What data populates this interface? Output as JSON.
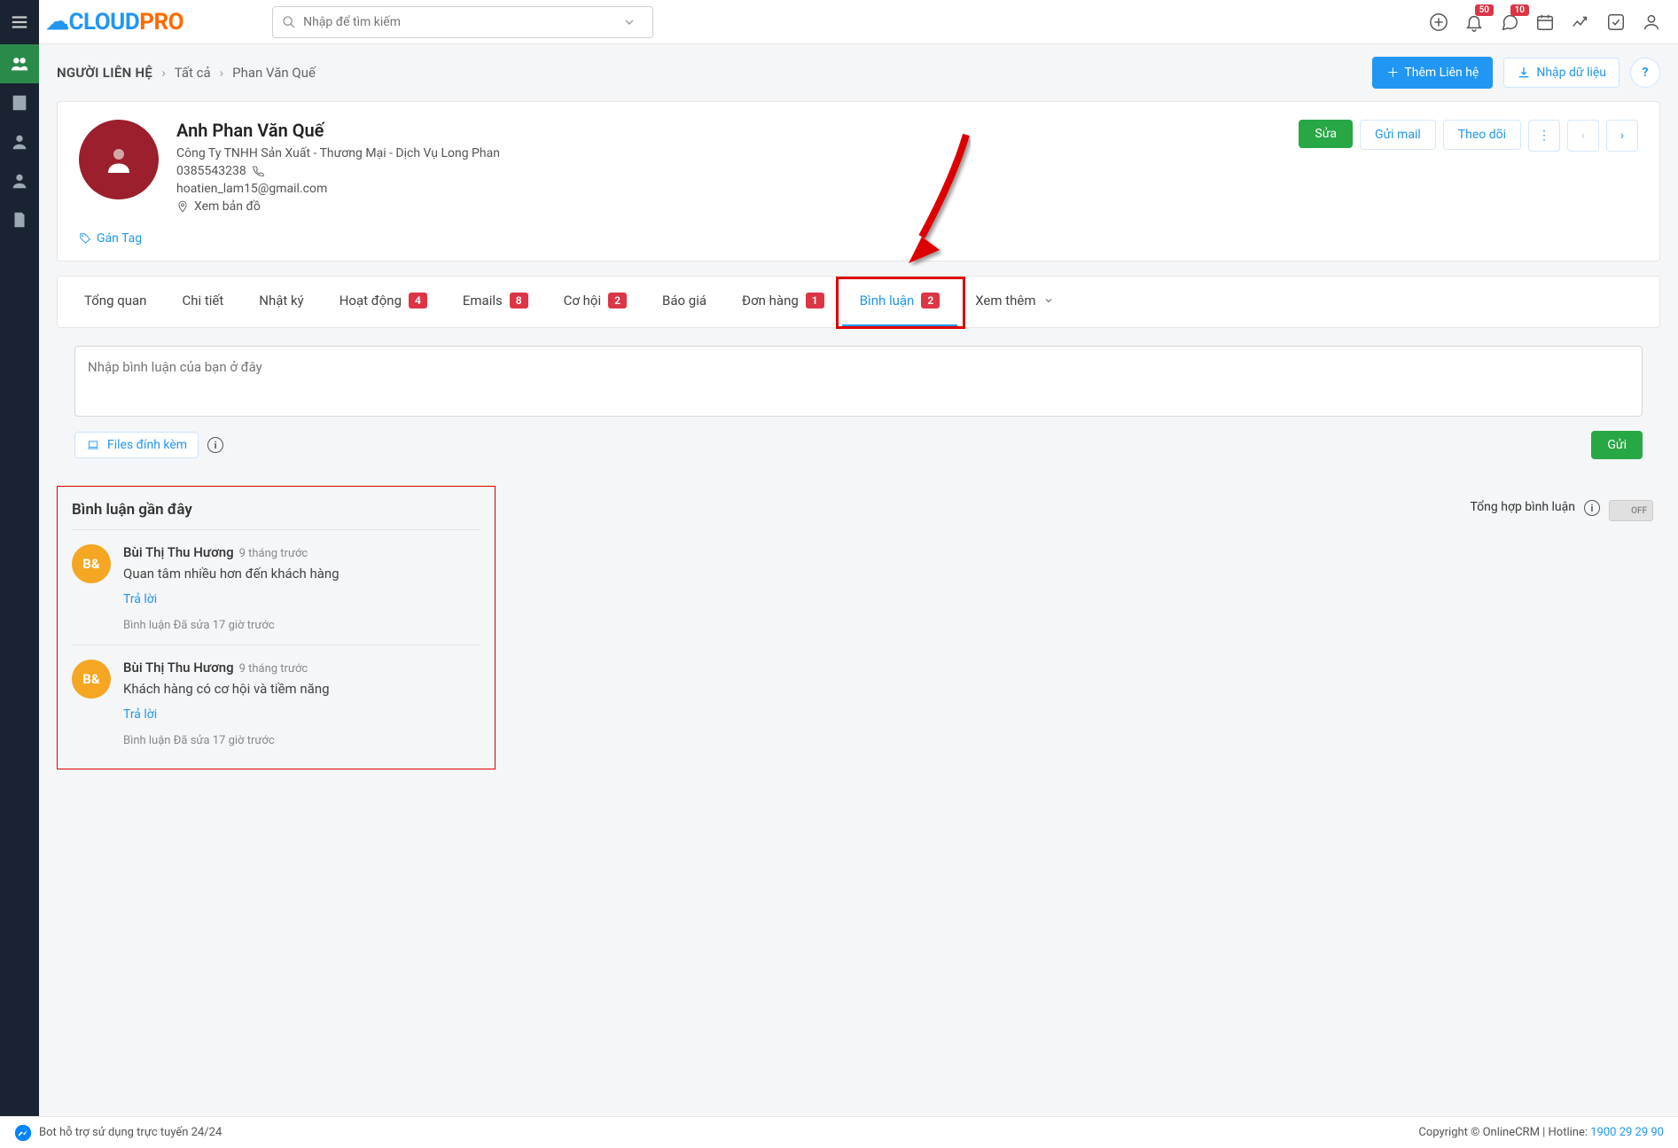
{
  "header": {
    "search_placeholder": "Nhập để tìm kiếm",
    "notif_count": "50",
    "chat_count": "10"
  },
  "breadcrumb": {
    "module": "NGƯỜI LIÊN HỆ",
    "filter": "Tất cả",
    "record": "Phan Văn Quế"
  },
  "page_actions": {
    "add_contact": "Thêm Liên hệ",
    "import": "Nhập dữ liệu"
  },
  "contact": {
    "name": "Anh Phan Văn Quế",
    "company": "Công Ty TNHH Sản Xuất - Thương Mại - Dịch Vụ Long Phan",
    "phone": "0385543238",
    "email": "hoatien_lam15@gmail.com",
    "view_map": "Xem bản đồ",
    "tag_link": "Gán Tag"
  },
  "contact_actions": {
    "edit": "Sửa",
    "send_mail": "Gửi mail",
    "follow": "Theo dõi"
  },
  "tabs": {
    "overview": "Tổng quan",
    "detail": "Chi tiết",
    "log": "Nhật ký",
    "activity": "Hoạt động",
    "activity_count": "4",
    "emails": "Emails",
    "emails_count": "8",
    "opportunity": "Cơ hội",
    "opportunity_count": "2",
    "quote": "Báo giá",
    "order": "Đơn hàng",
    "order_count": "1",
    "comments": "Bình luận",
    "comments_count": "2",
    "more": "Xem thêm"
  },
  "comment_input": {
    "placeholder": "Nhập bình luận của bạn ở đây",
    "files": "Files đính kèm",
    "send": "Gửi"
  },
  "recent": {
    "title": "Bình luận gần đây",
    "summary_label": "Tổng hợp bình luận",
    "toggle": "OFF",
    "items": [
      {
        "avatar": "B&",
        "author": "Bùi Thị Thu Hương",
        "time": "9 tháng trước",
        "text": "Quan tâm nhiều hơn đến khách hàng",
        "reply": "Trả lời",
        "edited": "Bình luận Đã sửa 17 giờ trước"
      },
      {
        "avatar": "B&",
        "author": "Bùi Thị Thu Hương",
        "time": "9 tháng trước",
        "text": "Khách hàng có cơ hội và tiềm năng",
        "reply": "Trả lời",
        "edited": "Bình luận Đã sửa 17 giờ trước"
      }
    ]
  },
  "footer": {
    "bot_text": "Bot hỗ trợ sử dụng trực tuyến 24/24",
    "copyright": "Copyright © OnlineCRM | Hotline: ",
    "hotline": "1900 29 29 90"
  }
}
